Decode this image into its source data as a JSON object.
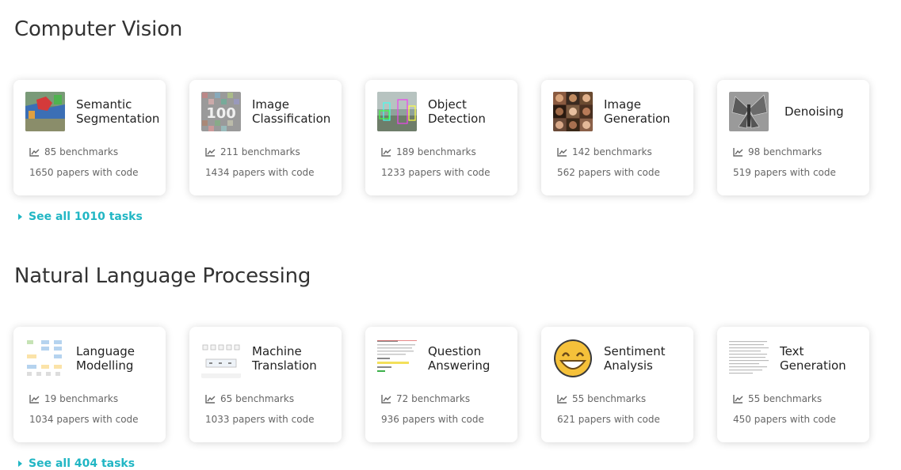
{
  "sections": [
    {
      "title": "Computer Vision",
      "see_all": "See all 1010 tasks",
      "tasks": [
        {
          "name": "Semantic Segmentation",
          "benchmarks": "85 benchmarks",
          "papers": "1650 papers with code",
          "icon": "segmentation-thumb"
        },
        {
          "name": "Image Classification",
          "benchmarks": "211 benchmarks",
          "papers": "1434 papers with code",
          "icon": "classification-thumb"
        },
        {
          "name": "Object Detection",
          "benchmarks": "189 benchmarks",
          "papers": "1233 papers with code",
          "icon": "detection-thumb"
        },
        {
          "name": "Image Generation",
          "benchmarks": "142 benchmarks",
          "papers": "562 papers with code",
          "icon": "generation-thumb"
        },
        {
          "name": "Denoising",
          "benchmarks": "98 benchmarks",
          "papers": "519 papers with code",
          "icon": "denoising-thumb"
        }
      ]
    },
    {
      "title": "Natural Language Processing",
      "see_all": "See all 404 tasks",
      "tasks": [
        {
          "name": "Language Modelling",
          "benchmarks": "19 benchmarks",
          "papers": "1034 papers with code",
          "icon": "language-modelling-thumb"
        },
        {
          "name": "Machine Translation",
          "benchmarks": "65 benchmarks",
          "papers": "1033 papers with code",
          "icon": "translation-thumb"
        },
        {
          "name": "Question Answering",
          "benchmarks": "72 benchmarks",
          "papers": "936 papers with code",
          "icon": "qa-thumb"
        },
        {
          "name": "Sentiment Analysis",
          "benchmarks": "55 benchmarks",
          "papers": "621 papers with code",
          "icon": "smiley-thumb"
        },
        {
          "name": "Text Generation",
          "benchmarks": "55 benchmarks",
          "papers": "450 papers with code",
          "icon": "text-thumb"
        }
      ]
    }
  ],
  "colors": {
    "link": "#21b6c4",
    "text": "#333333",
    "muted": "#666666"
  }
}
